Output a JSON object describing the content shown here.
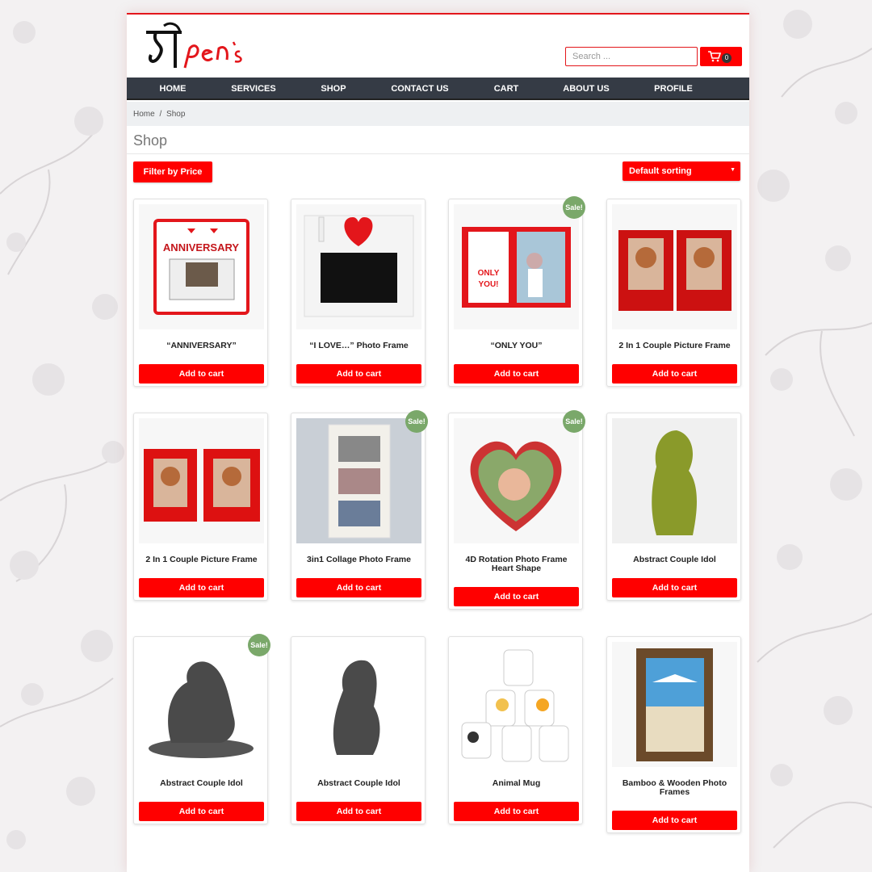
{
  "colors": {
    "accent": "#ff0000",
    "nav_bg": "#353b45",
    "sale_badge": "#7aa86a"
  },
  "brand": {
    "logo_text": "দীpen`s"
  },
  "search": {
    "placeholder": "Search ..."
  },
  "cart": {
    "count": "0",
    "icon": "shopping-cart-icon"
  },
  "nav": [
    {
      "label": "HOME"
    },
    {
      "label": "SERVICES"
    },
    {
      "label": "SHOP"
    },
    {
      "label": "CONTACT US"
    },
    {
      "label": "CART"
    },
    {
      "label": "ABOUT US"
    },
    {
      "label": "PROFILE"
    }
  ],
  "breadcrumb": {
    "home": "Home",
    "separator": "/",
    "current": "Shop"
  },
  "page_title": "Shop",
  "filter_button": "Filter by Price",
  "sorting": {
    "selected": "Default sorting"
  },
  "add_to_cart_label": "Add to cart",
  "sale_label": "Sale!",
  "products": [
    {
      "name": "“ANNIVERSARY”",
      "sale": false
    },
    {
      "name": "“I LOVE…” Photo Frame",
      "sale": false
    },
    {
      "name": "“ONLY YOU”",
      "sale": true
    },
    {
      "name": "2 In 1 Couple Picture Frame",
      "sale": false
    },
    {
      "name": "2 In 1 Couple Picture Frame",
      "sale": false
    },
    {
      "name": "3in1 Collage Photo Frame",
      "sale": true
    },
    {
      "name": "4D Rotation Photo Frame Heart Shape",
      "sale": true
    },
    {
      "name": "Abstract Couple Idol",
      "sale": false
    },
    {
      "name": "Abstract Couple Idol",
      "sale": true
    },
    {
      "name": "Abstract Couple Idol",
      "sale": false
    },
    {
      "name": "Animal Mug",
      "sale": false
    },
    {
      "name": "Bamboo & Wooden Photo Frames",
      "sale": false
    }
  ]
}
